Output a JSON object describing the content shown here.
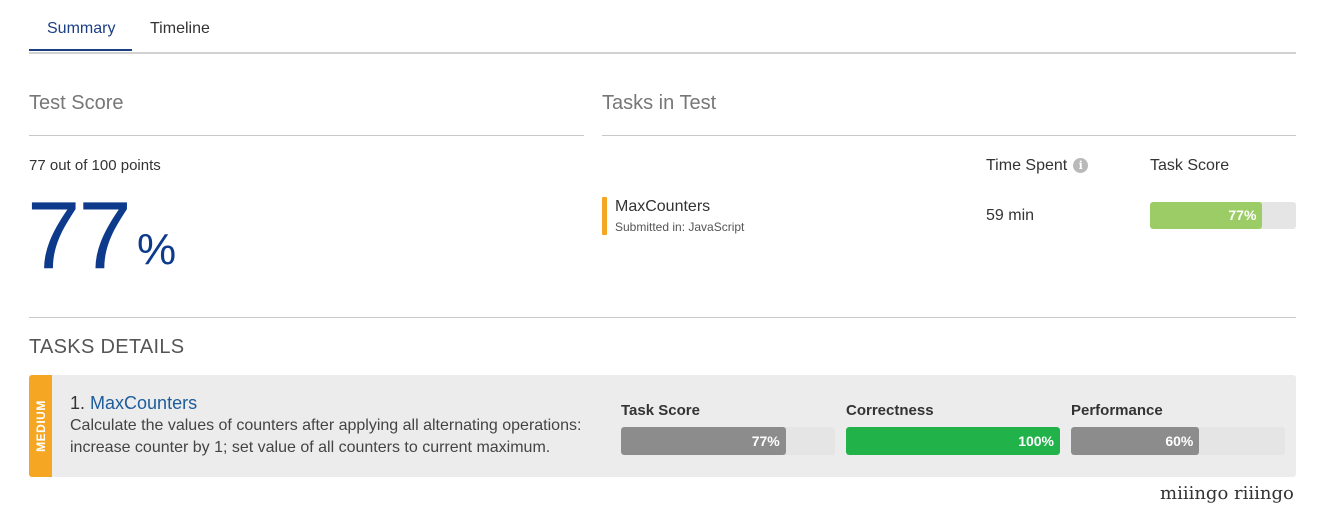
{
  "tabs": [
    {
      "label": "Summary",
      "active": true
    },
    {
      "label": "Timeline",
      "active": false
    }
  ],
  "test_score": {
    "heading": "Test Score",
    "summary": "77 out of 100 points",
    "value": "77",
    "unit": "%"
  },
  "tasks_in_test": {
    "heading": "Tasks in Test",
    "col_time": "Time Spent",
    "col_score": "Task Score",
    "info_icon": "info-icon",
    "tasks": [
      {
        "name": "MaxCounters",
        "submitted": "Submitted in: JavaScript",
        "time": "59 min",
        "score": 77,
        "score_label": "77%"
      }
    ]
  },
  "tasks_details": {
    "heading": "TASKS DETAILS",
    "items": [
      {
        "difficulty": "MEDIUM",
        "number": "1.",
        "name": "MaxCounters",
        "description": "Calculate the values of counters after applying all alternating operations: increase counter by 1; set value of all counters to current maximum.",
        "metrics": [
          {
            "label": "Task Score",
            "value": 77,
            "value_label": "77%",
            "color": "#8c8c8c"
          },
          {
            "label": "Correctness",
            "value": 100,
            "value_label": "100%",
            "color": "#21b24a"
          },
          {
            "label": "Performance",
            "value": 60,
            "value_label": "60%",
            "color": "#8c8c8c"
          }
        ]
      }
    ]
  },
  "colors": {
    "accent": "#1b3f84",
    "score_bar": "#9ccc65",
    "difficulty_medium": "#f5a623"
  },
  "watermark": "miiingo riiingo"
}
